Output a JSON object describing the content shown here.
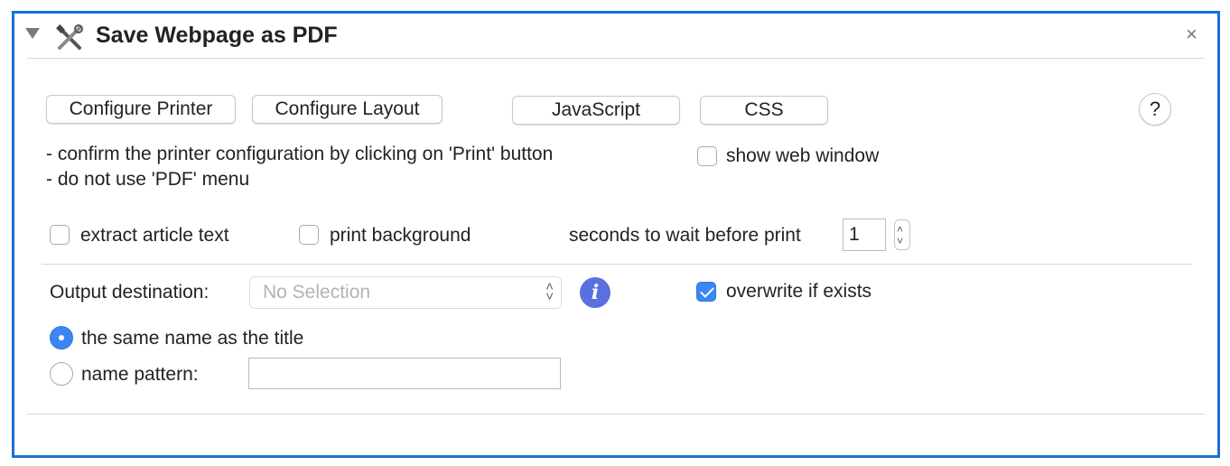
{
  "header": {
    "title": "Save Webpage as PDF",
    "close_glyph": "×",
    "action_icon": "tools-icon",
    "disclosure_icon": "disclosure-triangle-icon"
  },
  "buttons": {
    "configure_printer": "Configure Printer",
    "configure_layout": "Configure Layout",
    "javascript": "JavaScript",
    "css": "CSS",
    "help": "?"
  },
  "notes": {
    "line1": "- confirm the printer configuration by clicking on 'Print' button",
    "line2": "- do not use 'PDF' menu"
  },
  "options": {
    "show_web_window": {
      "label": "show web window",
      "checked": false
    },
    "extract_article_text": {
      "label": "extract article text",
      "checked": false
    },
    "print_background": {
      "label": "print background",
      "checked": false
    },
    "wait_label": "seconds to wait before print",
    "wait_value": "1"
  },
  "output": {
    "destination_label": "Output destination:",
    "destination_placeholder": "No Selection",
    "overwrite": {
      "label": "overwrite if exists",
      "checked": true
    },
    "same_name": {
      "label": "the same name as the title",
      "selected": true
    },
    "name_pattern": {
      "label": "name pattern:",
      "selected": false,
      "value": ""
    }
  },
  "colors": {
    "panel_border": "#1c6fd6",
    "accent": "#3b86f5",
    "info": "#5b6fe0"
  }
}
